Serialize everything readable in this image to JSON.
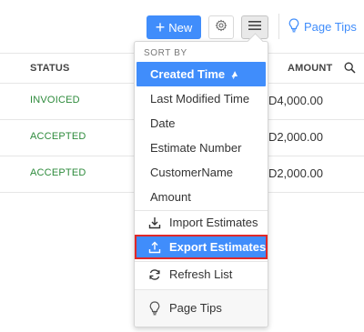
{
  "toolbar": {
    "new_label": "New",
    "page_tips_label": "Page Tips",
    "accent_color": "#408dfb"
  },
  "table": {
    "headers": {
      "status": "STATUS",
      "amount": "AMOUNT"
    },
    "rows": [
      {
        "status": "INVOICED",
        "amount": "ZD4,000.00"
      },
      {
        "status": "ACCEPTED",
        "amount": "ZD2,000.00"
      },
      {
        "status": "ACCEPTED",
        "amount": "ZD2,000.00"
      }
    ]
  },
  "dropdown": {
    "sort_title": "SORT BY",
    "sort_options": [
      "Created Time",
      "Last Modified Time",
      "Date",
      "Estimate Number",
      "CustomerName",
      "Amount"
    ],
    "selected_sort": "Created Time",
    "actions": {
      "import": "Import Estimates",
      "export": "Export Estimates",
      "refresh": "Refresh List",
      "page_tips": "Page Tips"
    },
    "icons": {
      "import": "download-icon",
      "export": "upload-icon",
      "refresh": "refresh-icon",
      "page_tips": "lightbulb-icon"
    }
  },
  "colors": {
    "status_green": "#2e8b3c",
    "highlight_border": "#e02828"
  }
}
